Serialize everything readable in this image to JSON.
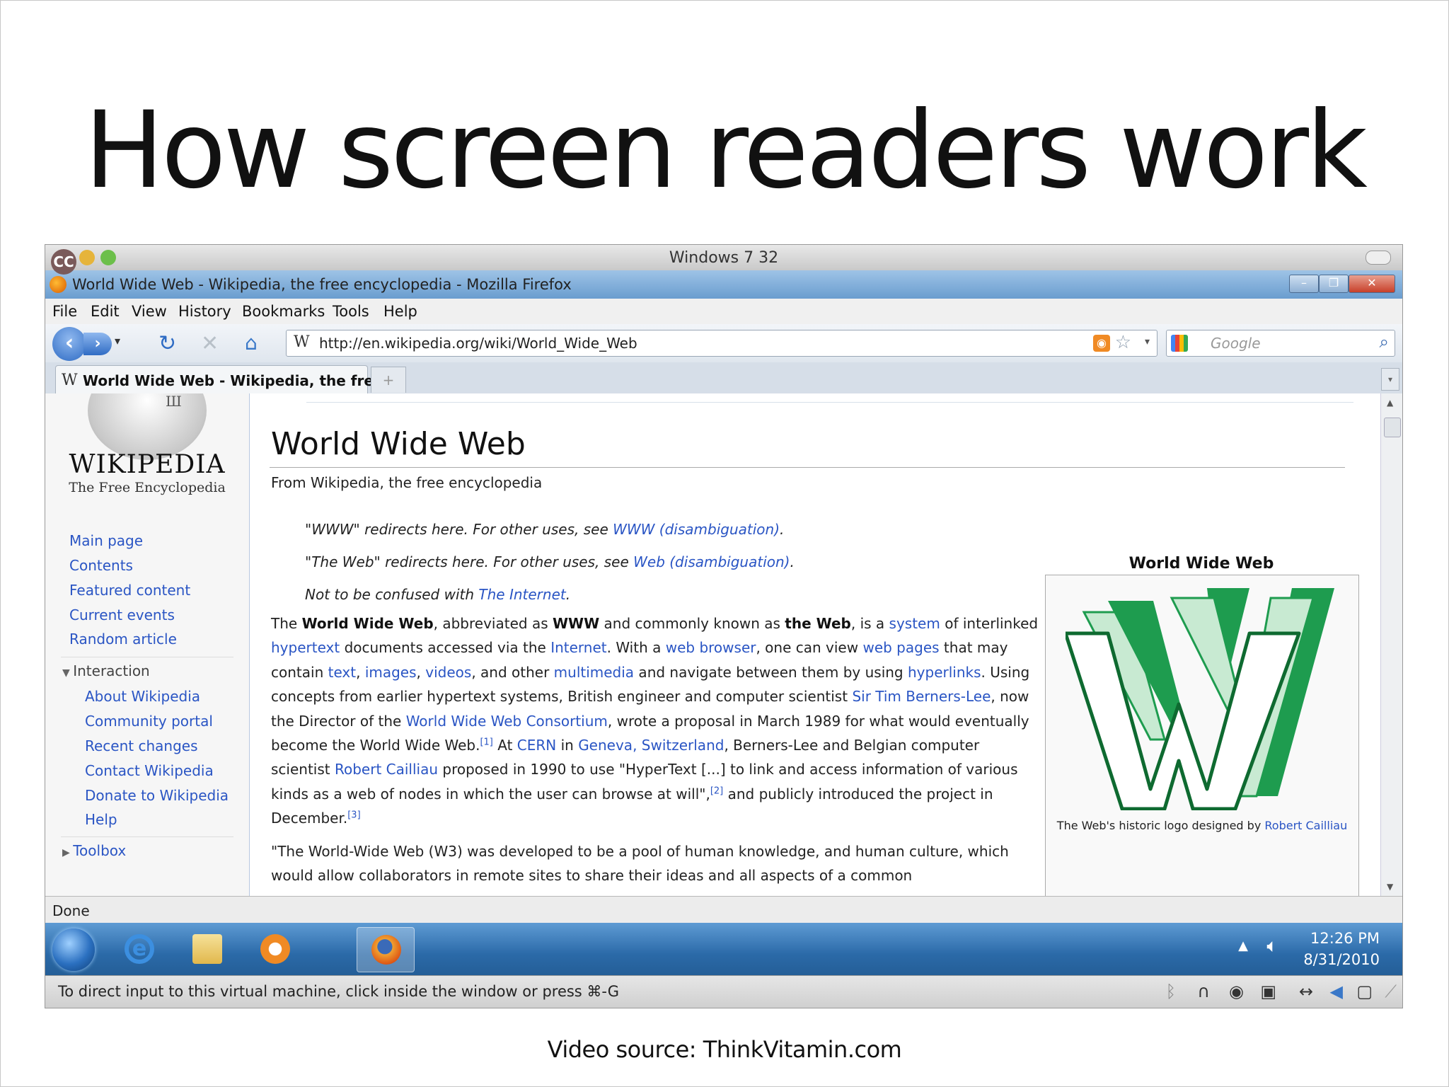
{
  "slide": {
    "title": "How screen readers work",
    "video_source": "Video source: ThinkVitamin.com"
  },
  "mac": {
    "window_title": "Windows 7 32",
    "cc_badge": "CC"
  },
  "firefox": {
    "window_title": "World Wide Web - Wikipedia, the free encyclopedia - Mozilla Firefox",
    "menu": [
      "File",
      "Edit",
      "View",
      "History",
      "Bookmarks",
      "Tools",
      "Help"
    ],
    "url": "http://en.wikipedia.org/wiki/World_Wide_Web",
    "search_placeholder": "Google",
    "tab_label": "World Wide Web - Wikipedia, the fre...",
    "status": "Done"
  },
  "wikipedia": {
    "wordmark": "WIKIPEDIA",
    "tagline": "The Free Encyclopedia",
    "nav": [
      "Main page",
      "Contents",
      "Featured content",
      "Current events",
      "Random article"
    ],
    "interaction_heading": "Interaction",
    "interaction": [
      "About Wikipedia",
      "Community portal",
      "Recent changes",
      "Contact Wikipedia",
      "Donate to Wikipedia",
      "Help"
    ],
    "toolbox_heading": "Toolbox"
  },
  "article": {
    "title": "World Wide Web",
    "from": "From Wikipedia, the free encyclopedia",
    "hatnote1_text": "\"WWW\" redirects here. For other uses, see ",
    "hatnote1_link": "WWW (disambiguation)",
    "hatnote2_text": "\"The Web\" redirects here. For other uses, see ",
    "hatnote2_link": "Web (disambiguation)",
    "hatnote3_text": "Not to be confused with ",
    "hatnote3_link": "The Internet",
    "para1": {
      "t1": "The ",
      "b1": "World Wide Web",
      "t2": ", abbreviated as ",
      "b2": "WWW",
      "t3": " and commonly known as ",
      "b3": "the Web",
      "t4": ", is a ",
      "l1": "system",
      "t5": " of interlinked ",
      "l2": "hypertext",
      "t6": " documents accessed via the ",
      "l3": "Internet",
      "t7": ". With a ",
      "l4": "web browser",
      "t8": ", one can view ",
      "l5": "web pages",
      "t9": " that may contain ",
      "l6": "text",
      "t10": ", ",
      "l7": "images",
      "t11": ", ",
      "l8": "videos",
      "t12": ", and other ",
      "l9": "multimedia",
      "t13": " and navigate between them by using ",
      "l10": "hyperlinks",
      "t14": ". Using concepts from earlier hypertext systems, British engineer and computer scientist ",
      "l11": "Sir Tim Berners-Lee",
      "t15": ", now the Director of the ",
      "l12": "World Wide Web Consortium",
      "t16": ", wrote a proposal in March 1989 for what would eventually become the World Wide Web.",
      "s1": "[1]",
      "t17": " At ",
      "l13": "CERN",
      "t18": " in ",
      "l14": "Geneva, Switzerland",
      "t19": ", Berners-Lee and Belgian computer scientist ",
      "l15": "Robert Cailliau",
      "t20": " proposed in 1990 to use \"HyperText [...] to link and access information of various kinds as a web of nodes in which the user can browse at will\",",
      "s2": "[2]",
      "t21": " and publicly introduced the project in December.",
      "s3": "[3]"
    },
    "para2": "\"The World-Wide Web (W3) was developed to be a pool of human knowledge, and human culture, which would allow collaborators in remote sites to share their ideas and all aspects of a common"
  },
  "infobox": {
    "title": "World Wide Web",
    "caption_text": "The Web's historic logo designed by ",
    "caption_link": "Robert Cailliau"
  },
  "taskbar": {
    "time": "12:26 PM",
    "date": "8/31/2010"
  },
  "vm_status": {
    "text": "To direct input to this virtual machine, click inside the window or press ⌘-G"
  },
  "colors": {
    "link": "#2a55c4",
    "w_logo_green": "#1e9c4f",
    "w_logo_light": "#c8ead2"
  }
}
